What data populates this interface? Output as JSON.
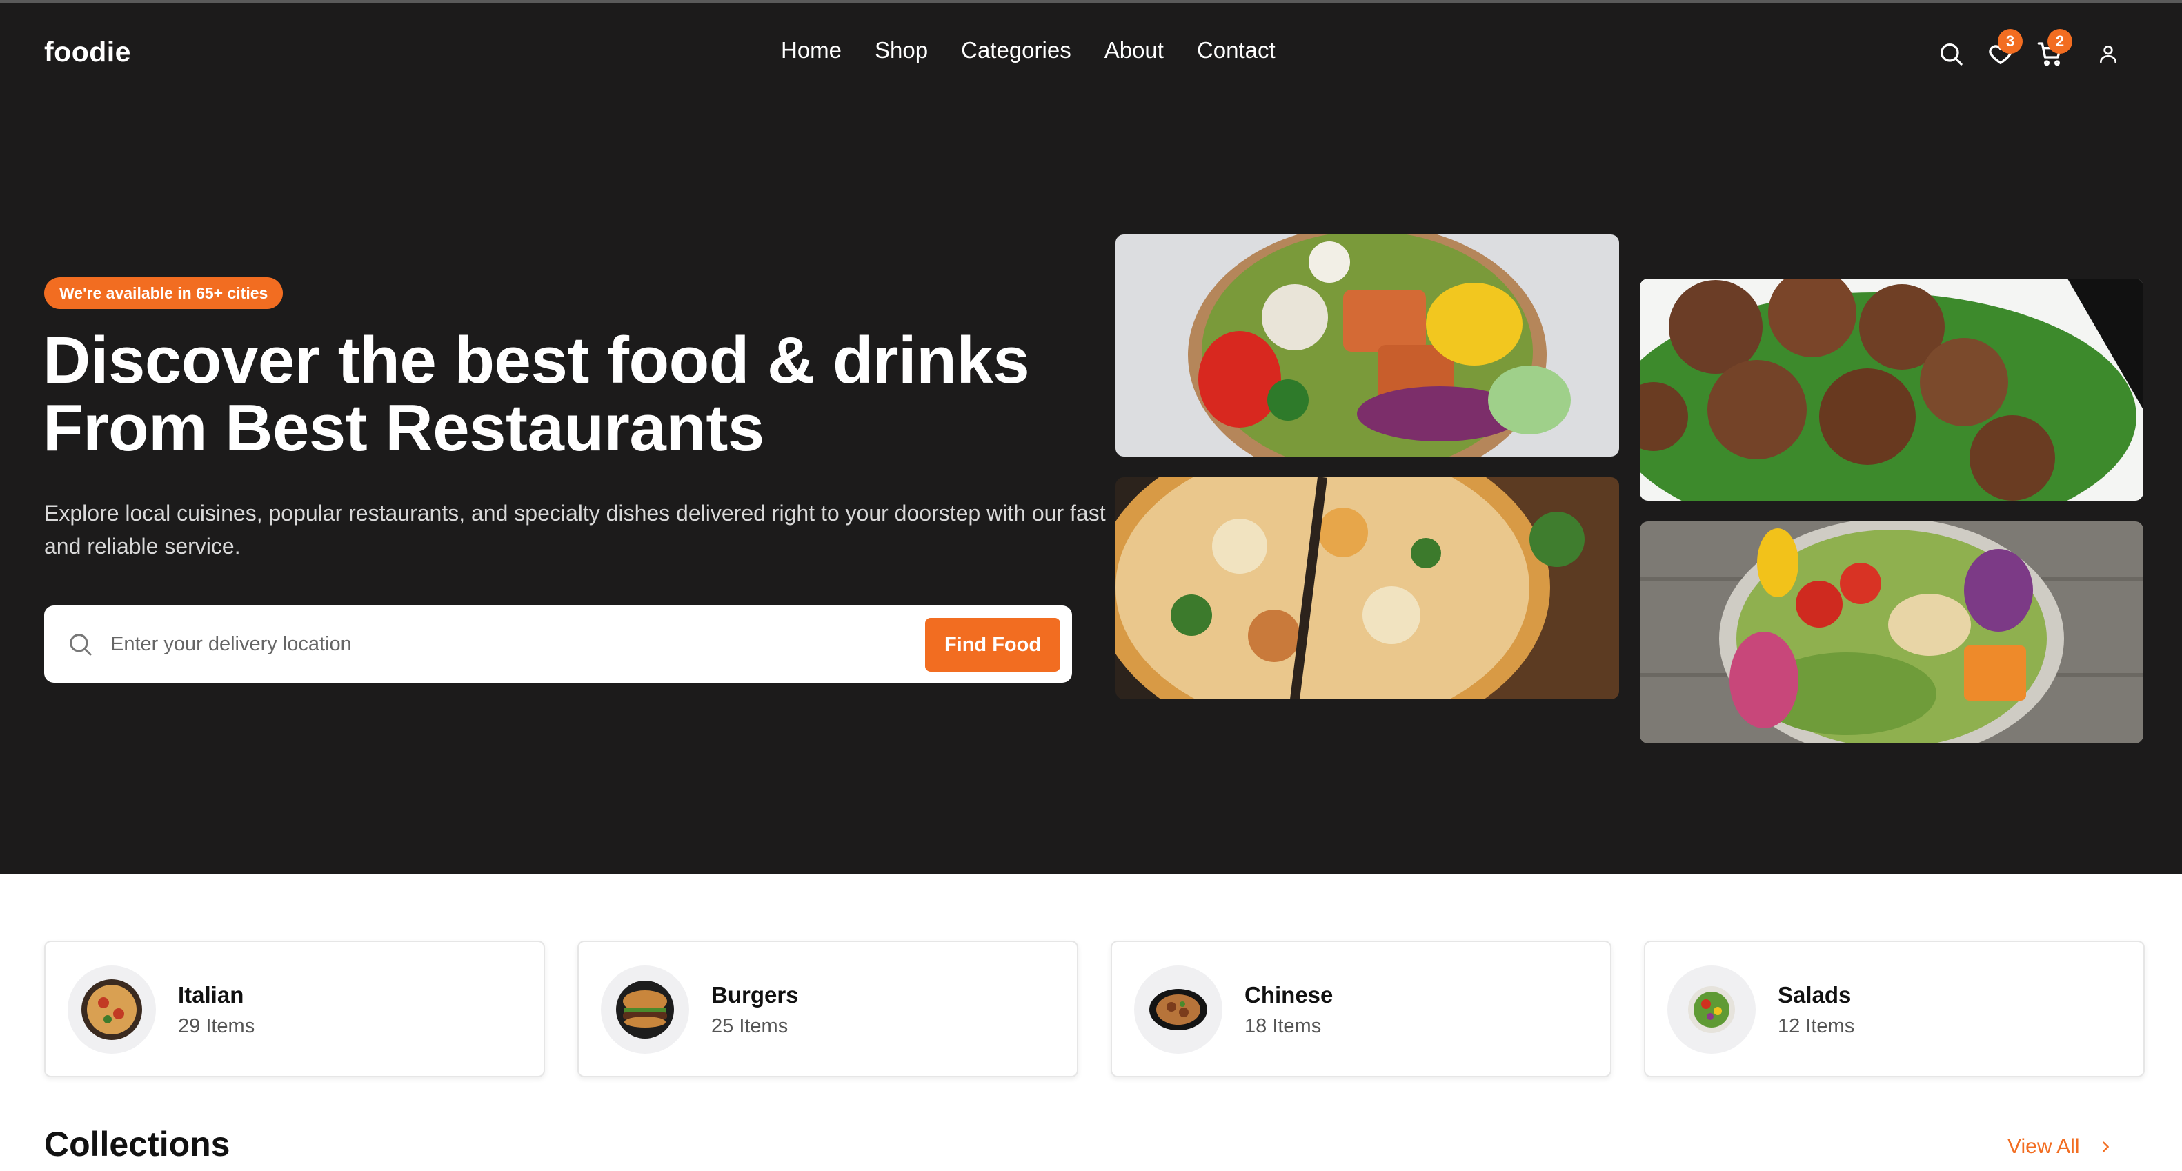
{
  "brand": {
    "logo": "foodie",
    "accent": "#f26d21",
    "hero_bg": "#1c1b1b"
  },
  "nav": {
    "items": [
      "Home",
      "Shop",
      "Categories",
      "About",
      "Contact"
    ]
  },
  "header_icons": {
    "search": "search-icon",
    "wishlist": {
      "icon": "heart-icon",
      "badge": "3"
    },
    "cart": {
      "icon": "cart-icon",
      "badge": "2"
    },
    "account": "user-icon"
  },
  "hero": {
    "pill": "We're available in 65+ cities",
    "title_line1": "Discover the best food & drinks",
    "title_line2": "From Best Restaurants",
    "description": "Explore local cuisines, popular restaurants, and specialty dishes delivered right to your doorstep with our fast and reliable service.",
    "search_placeholder": "Enter your delivery location",
    "search_button": "Find Food"
  },
  "hero_images": [
    "salad-bowl",
    "pizza",
    "meatballs",
    "veggie-bowl"
  ],
  "categories": [
    {
      "name": "Italian",
      "count": "29 Items"
    },
    {
      "name": "Burgers",
      "count": "25 Items"
    },
    {
      "name": "Chinese",
      "count": "18 Items"
    },
    {
      "name": "Salads",
      "count": "12 Items"
    }
  ],
  "collections": {
    "title": "Collections",
    "view_all": "View All"
  }
}
